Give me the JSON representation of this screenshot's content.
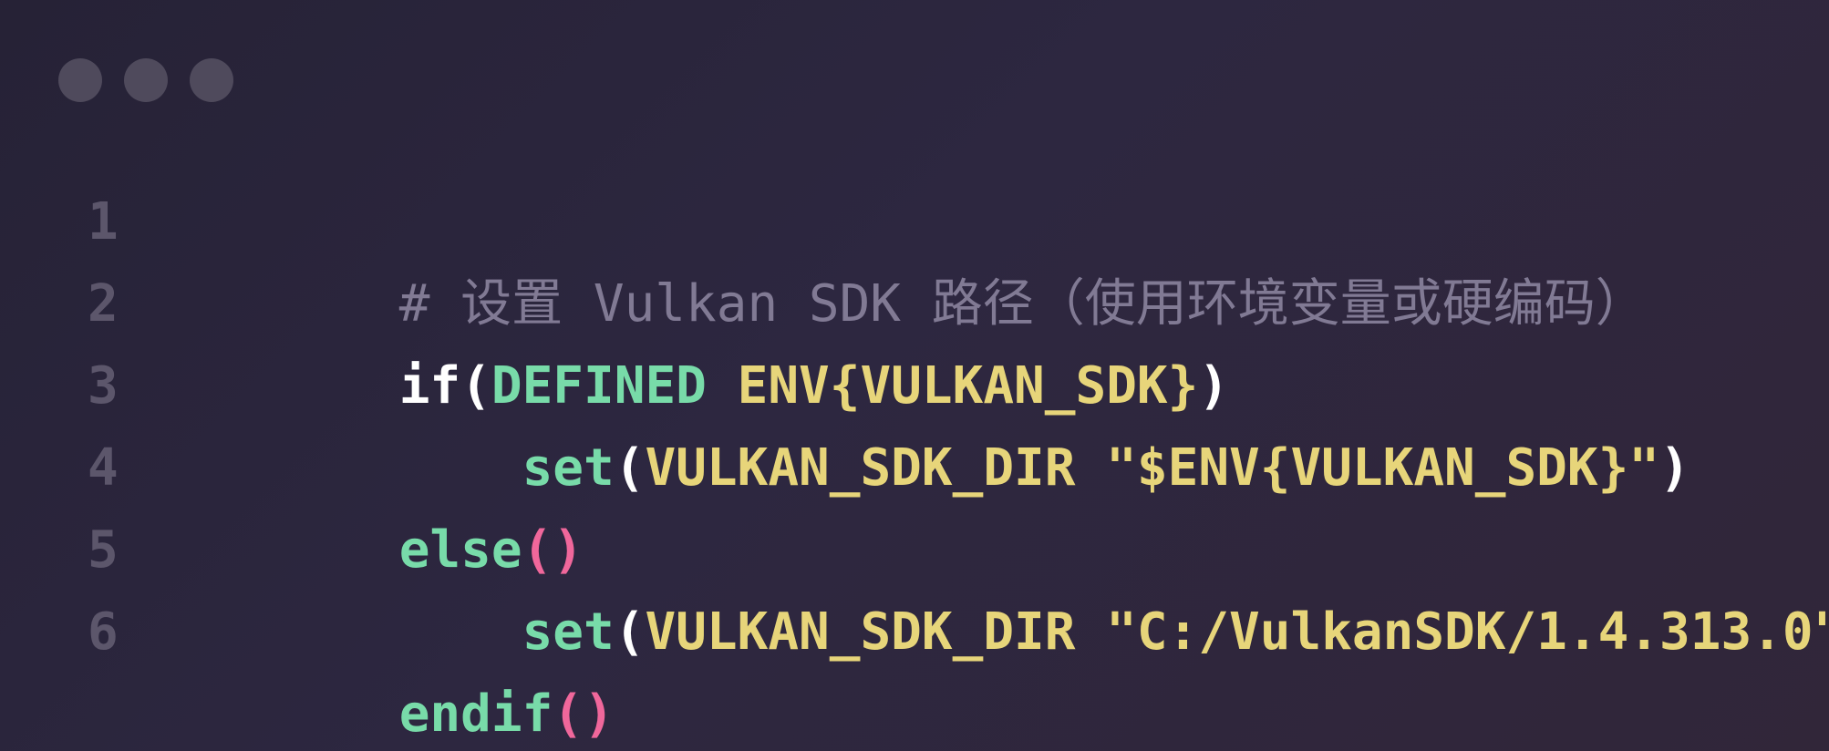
{
  "window": {
    "controls": [
      "close-dot",
      "minimize-dot",
      "maximize-dot"
    ]
  },
  "colors": {
    "background": "#2b2539",
    "line_number": "#5c566b",
    "comment": "#817a94",
    "keyword_white": "#ffffff",
    "green": "#78dba9",
    "yellow": "#e7d57a",
    "pink": "#f0679b"
  },
  "code": {
    "lines": [
      {
        "number": "1",
        "tokens": [
          "# 设置 Vulkan SDK 路径（使用环境变量或硬编码）"
        ]
      },
      {
        "number": "2",
        "tokens": [
          "if",
          "(",
          "DEFINED",
          " ",
          "ENV{VULKAN_SDK}",
          ")"
        ]
      },
      {
        "number": "3",
        "tokens": [
          "    ",
          "set",
          "(",
          "VULKAN_SDK_DIR \"$ENV{VULKAN_SDK}\"",
          ")"
        ]
      },
      {
        "number": "4",
        "tokens": [
          "else",
          "()"
        ]
      },
      {
        "number": "5",
        "tokens": [
          "    ",
          "set",
          "(",
          "VULKAN_SDK_DIR \"C:/VulkanSDK/1.4.313.0\"",
          ")"
        ]
      },
      {
        "number": "6",
        "tokens": [
          "endif",
          "()"
        ]
      }
    ]
  }
}
